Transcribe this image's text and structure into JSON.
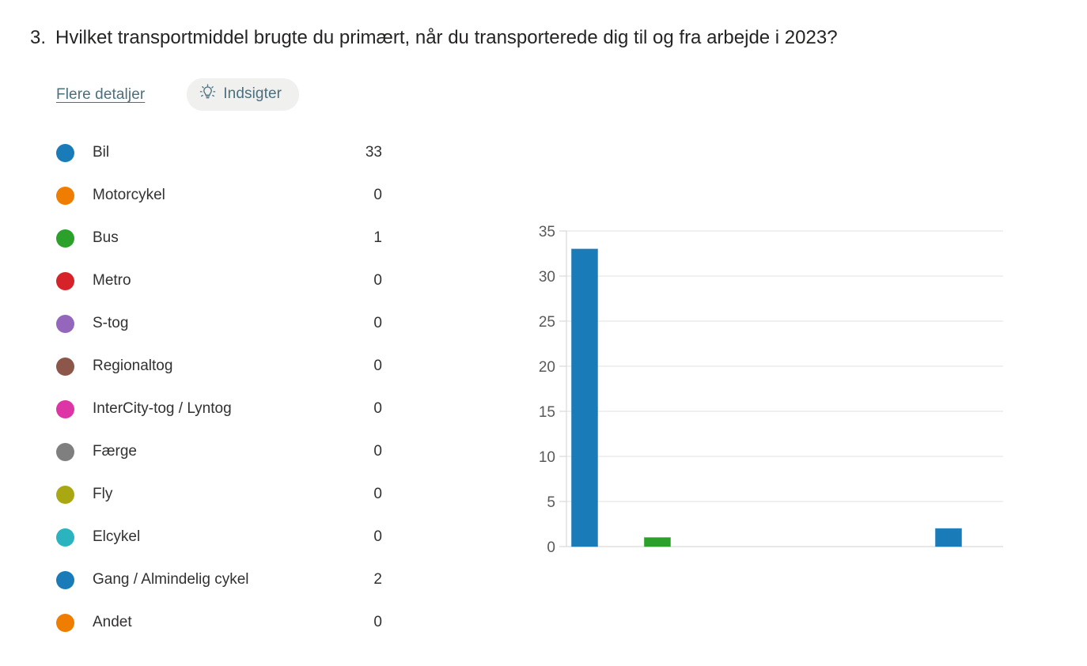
{
  "question": {
    "number": "3.",
    "text": "Hvilket transportmiddel brugte du primært, når du transporterede dig til og fra arbejde i 2023?"
  },
  "actions": {
    "details_link": "Flere detaljer",
    "insights_label": "Indsigter",
    "insights_icon": "lightbulb-icon"
  },
  "legend": {
    "items": [
      {
        "label": "Bil",
        "count": "33",
        "color": "#1a7bb9"
      },
      {
        "label": "Motorcykel",
        "count": "0",
        "color": "#ef7d00"
      },
      {
        "label": "Bus",
        "count": "1",
        "color": "#2ba02b"
      },
      {
        "label": "Metro",
        "count": "0",
        "color": "#d62229"
      },
      {
        "label": "S-tog",
        "count": "0",
        "color": "#9467bd"
      },
      {
        "label": "Regionaltog",
        "count": "0",
        "color": "#8c564b"
      },
      {
        "label": "InterCity-tog / Lyntog",
        "count": "0",
        "color": "#dd34a6"
      },
      {
        "label": "Færge",
        "count": "0",
        "color": "#7f7f7f"
      },
      {
        "label": "Fly",
        "count": "0",
        "color": "#a9a812"
      },
      {
        "label": "Elcykel",
        "count": "0",
        "color": "#2bb4c0"
      },
      {
        "label": "Gang / Almindelig cykel",
        "count": "2",
        "color": "#1a7bb9"
      },
      {
        "label": "Andet",
        "count": "0",
        "color": "#ef7d00"
      }
    ]
  },
  "chart_data": {
    "type": "bar",
    "title": "",
    "xlabel": "",
    "ylabel": "",
    "categories": [
      "Bil",
      "Motorcykel",
      "Bus",
      "Metro",
      "S-tog",
      "Regionaltog",
      "InterCity-tog / Lyntog",
      "Færge",
      "Fly",
      "Elcykel",
      "Gang / Almindelig cykel",
      "Andet"
    ],
    "values": [
      33,
      0,
      1,
      0,
      0,
      0,
      0,
      0,
      0,
      0,
      2,
      0
    ],
    "bar_colors": [
      "#1a7bb9",
      "#ef7d00",
      "#2ba02b",
      "#d62229",
      "#9467bd",
      "#8c564b",
      "#dd34a6",
      "#7f7f7f",
      "#a9a812",
      "#2bb4c0",
      "#1a7bb9",
      "#ef7d00"
    ],
    "ylim": [
      0,
      35
    ],
    "yticks": [
      0,
      5,
      10,
      15,
      20,
      25,
      30,
      35
    ],
    "ytick_labels": [
      "0",
      "5",
      "10",
      "15",
      "20",
      "25",
      "30",
      "35"
    ],
    "xtick_labels": [],
    "grid": true,
    "grid_axis": "y",
    "legend": "external-left",
    "axis_color": "#d9d9d9",
    "grid_color": "#e8e8e8",
    "tick_label_color": "#595959"
  }
}
